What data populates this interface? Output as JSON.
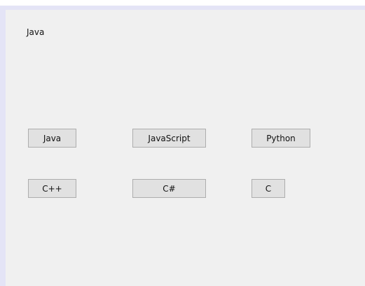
{
  "selected_language": "Java",
  "buttons": [
    {
      "label": "Java"
    },
    {
      "label": "JavaScript"
    },
    {
      "label": "Python"
    },
    {
      "label": "C++"
    },
    {
      "label": "C#"
    },
    {
      "label": "C"
    }
  ]
}
